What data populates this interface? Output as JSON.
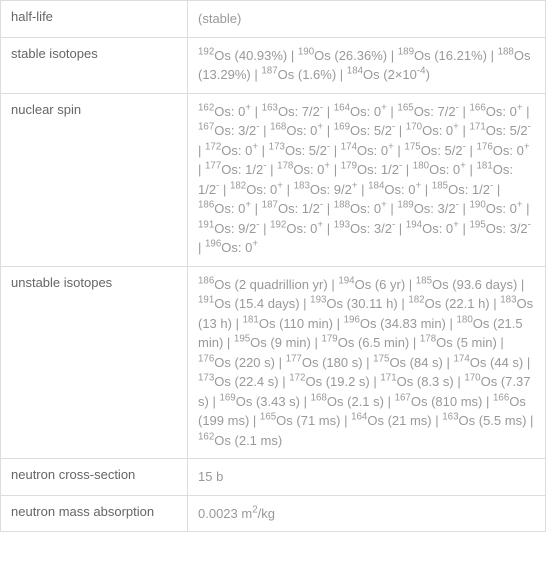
{
  "rows": [
    {
      "label": "half-life",
      "value_html": "(stable)"
    },
    {
      "label": "stable isotopes",
      "value_html": "<sup>192</sup>Os (40.93%) | <sup>190</sup>Os (26.36%) | <sup>189</sup>Os (16.21%) | <sup>188</sup>Os (13.29%) | <sup>187</sup>Os (1.6%) | <sup>184</sup>Os (2×10<sup>-4</sup>)"
    },
    {
      "label": "nuclear spin",
      "value_html": "<sup>162</sup>Os: 0<sup>+</sup> | <sup>163</sup>Os: 7/2<sup>-</sup> | <sup>164</sup>Os: 0<sup>+</sup> | <sup>165</sup>Os: 7/2<sup>-</sup> | <sup>166</sup>Os: 0<sup>+</sup> | <sup>167</sup>Os: 3/2<sup>-</sup> | <sup>168</sup>Os: 0<sup>+</sup> | <sup>169</sup>Os: 5/2<sup>-</sup> | <sup>170</sup>Os: 0<sup>+</sup> | <sup>171</sup>Os: 5/2<sup>-</sup> | <sup>172</sup>Os: 0<sup>+</sup> | <sup>173</sup>Os: 5/2<sup>-</sup> | <sup>174</sup>Os: 0<sup>+</sup> | <sup>175</sup>Os: 5/2<sup>-</sup> | <sup>176</sup>Os: 0<sup>+</sup> | <sup>177</sup>Os: 1/2<sup>-</sup> | <sup>178</sup>Os: 0<sup>+</sup> | <sup>179</sup>Os: 1/2<sup>-</sup> | <sup>180</sup>Os: 0<sup>+</sup> | <sup>181</sup>Os: 1/2<sup>-</sup> | <sup>182</sup>Os: 0<sup>+</sup> | <sup>183</sup>Os: 9/2<sup>+</sup> | <sup>184</sup>Os: 0<sup>+</sup> | <sup>185</sup>Os: 1/2<sup>-</sup> | <sup>186</sup>Os: 0<sup>+</sup> | <sup>187</sup>Os: 1/2<sup>-</sup> | <sup>188</sup>Os: 0<sup>+</sup> | <sup>189</sup>Os: 3/2<sup>-</sup> | <sup>190</sup>Os: 0<sup>+</sup> | <sup>191</sup>Os: 9/2<sup>-</sup> | <sup>192</sup>Os: 0<sup>+</sup> | <sup>193</sup>Os: 3/2<sup>-</sup> | <sup>194</sup>Os: 0<sup>+</sup> | <sup>195</sup>Os: 3/2<sup>-</sup> | <sup>196</sup>Os: 0<sup>+</sup>"
    },
    {
      "label": "unstable isotopes",
      "value_html": "<sup>186</sup>Os (2 quadrillion yr) | <sup>194</sup>Os (6 yr) | <sup>185</sup>Os (93.6 days) | <sup>191</sup>Os (15.4 days) | <sup>193</sup>Os (30.11 h) | <sup>182</sup>Os (22.1 h) | <sup>183</sup>Os (13 h) | <sup>181</sup>Os (110 min) | <sup>196</sup>Os (34.83 min) | <sup>180</sup>Os (21.5 min) | <sup>195</sup>Os (9 min) | <sup>179</sup>Os (6.5 min) | <sup>178</sup>Os (5 min) | <sup>176</sup>Os (220 s) | <sup>177</sup>Os (180 s) | <sup>175</sup>Os (84 s) | <sup>174</sup>Os (44 s) | <sup>173</sup>Os (22.4 s) | <sup>172</sup>Os (19.2 s) | <sup>171</sup>Os (8.3 s) | <sup>170</sup>Os (7.37 s) | <sup>169</sup>Os (3.43 s) | <sup>168</sup>Os (2.1 s) | <sup>167</sup>Os (810 ms) | <sup>166</sup>Os (199 ms) | <sup>165</sup>Os (71 ms) | <sup>164</sup>Os (21 ms) | <sup>163</sup>Os (5.5 ms) | <sup>162</sup>Os (2.1 ms)"
    },
    {
      "label": "neutron cross-section",
      "value_html": "15 b"
    },
    {
      "label": "neutron mass absorption",
      "value_html": "0.0023 m<sup>2</sup>/kg"
    }
  ],
  "chart_data": {
    "type": "table",
    "title": "Osmium nuclear properties",
    "rows": [
      {
        "property": "half-life",
        "value": "(stable)"
      },
      {
        "property": "stable isotopes",
        "isotopes": [
          {
            "isotope": "192Os",
            "abundance_pct": 40.93
          },
          {
            "isotope": "190Os",
            "abundance_pct": 26.36
          },
          {
            "isotope": "189Os",
            "abundance_pct": 16.21
          },
          {
            "isotope": "188Os",
            "abundance_pct": 13.29
          },
          {
            "isotope": "187Os",
            "abundance_pct": 1.6
          },
          {
            "isotope": "184Os",
            "abundance": "2×10^-4"
          }
        ]
      },
      {
        "property": "nuclear spin",
        "spins": [
          {
            "isotope": "162Os",
            "spin": "0+"
          },
          {
            "isotope": "163Os",
            "spin": "7/2-"
          },
          {
            "isotope": "164Os",
            "spin": "0+"
          },
          {
            "isotope": "165Os",
            "spin": "7/2-"
          },
          {
            "isotope": "166Os",
            "spin": "0+"
          },
          {
            "isotope": "167Os",
            "spin": "3/2-"
          },
          {
            "isotope": "168Os",
            "spin": "0+"
          },
          {
            "isotope": "169Os",
            "spin": "5/2-"
          },
          {
            "isotope": "170Os",
            "spin": "0+"
          },
          {
            "isotope": "171Os",
            "spin": "5/2-"
          },
          {
            "isotope": "172Os",
            "spin": "0+"
          },
          {
            "isotope": "173Os",
            "spin": "5/2-"
          },
          {
            "isotope": "174Os",
            "spin": "0+"
          },
          {
            "isotope": "175Os",
            "spin": "5/2-"
          },
          {
            "isotope": "176Os",
            "spin": "0+"
          },
          {
            "isotope": "177Os",
            "spin": "1/2-"
          },
          {
            "isotope": "178Os",
            "spin": "0+"
          },
          {
            "isotope": "179Os",
            "spin": "1/2-"
          },
          {
            "isotope": "180Os",
            "spin": "0+"
          },
          {
            "isotope": "181Os",
            "spin": "1/2-"
          },
          {
            "isotope": "182Os",
            "spin": "0+"
          },
          {
            "isotope": "183Os",
            "spin": "9/2+"
          },
          {
            "isotope": "184Os",
            "spin": "0+"
          },
          {
            "isotope": "185Os",
            "spin": "1/2-"
          },
          {
            "isotope": "186Os",
            "spin": "0+"
          },
          {
            "isotope": "187Os",
            "spin": "1/2-"
          },
          {
            "isotope": "188Os",
            "spin": "0+"
          },
          {
            "isotope": "189Os",
            "spin": "3/2-"
          },
          {
            "isotope": "190Os",
            "spin": "0+"
          },
          {
            "isotope": "191Os",
            "spin": "9/2-"
          },
          {
            "isotope": "192Os",
            "spin": "0+"
          },
          {
            "isotope": "193Os",
            "spin": "3/2-"
          },
          {
            "isotope": "194Os",
            "spin": "0+"
          },
          {
            "isotope": "195Os",
            "spin": "3/2-"
          },
          {
            "isotope": "196Os",
            "spin": "0+"
          }
        ]
      },
      {
        "property": "unstable isotopes",
        "isotopes": [
          {
            "isotope": "186Os",
            "half_life": "2 quadrillion yr"
          },
          {
            "isotope": "194Os",
            "half_life": "6 yr"
          },
          {
            "isotope": "185Os",
            "half_life": "93.6 days"
          },
          {
            "isotope": "191Os",
            "half_life": "15.4 days"
          },
          {
            "isotope": "193Os",
            "half_life": "30.11 h"
          },
          {
            "isotope": "182Os",
            "half_life": "22.1 h"
          },
          {
            "isotope": "183Os",
            "half_life": "13 h"
          },
          {
            "isotope": "181Os",
            "half_life": "110 min"
          },
          {
            "isotope": "196Os",
            "half_life": "34.83 min"
          },
          {
            "isotope": "180Os",
            "half_life": "21.5 min"
          },
          {
            "isotope": "195Os",
            "half_life": "9 min"
          },
          {
            "isotope": "179Os",
            "half_life": "6.5 min"
          },
          {
            "isotope": "178Os",
            "half_life": "5 min"
          },
          {
            "isotope": "176Os",
            "half_life": "220 s"
          },
          {
            "isotope": "177Os",
            "half_life": "180 s"
          },
          {
            "isotope": "175Os",
            "half_life": "84 s"
          },
          {
            "isotope": "174Os",
            "half_life": "44 s"
          },
          {
            "isotope": "173Os",
            "half_life": "22.4 s"
          },
          {
            "isotope": "172Os",
            "half_life": "19.2 s"
          },
          {
            "isotope": "171Os",
            "half_life": "8.3 s"
          },
          {
            "isotope": "170Os",
            "half_life": "7.37 s"
          },
          {
            "isotope": "169Os",
            "half_life": "3.43 s"
          },
          {
            "isotope": "168Os",
            "half_life": "2.1 s"
          },
          {
            "isotope": "167Os",
            "half_life": "810 ms"
          },
          {
            "isotope": "166Os",
            "half_life": "199 ms"
          },
          {
            "isotope": "165Os",
            "half_life": "71 ms"
          },
          {
            "isotope": "164Os",
            "half_life": "21 ms"
          },
          {
            "isotope": "163Os",
            "half_life": "5.5 ms"
          },
          {
            "isotope": "162Os",
            "half_life": "2.1 ms"
          }
        ]
      },
      {
        "property": "neutron cross-section",
        "value": "15 b"
      },
      {
        "property": "neutron mass absorption",
        "value": "0.0023 m^2/kg"
      }
    ]
  }
}
